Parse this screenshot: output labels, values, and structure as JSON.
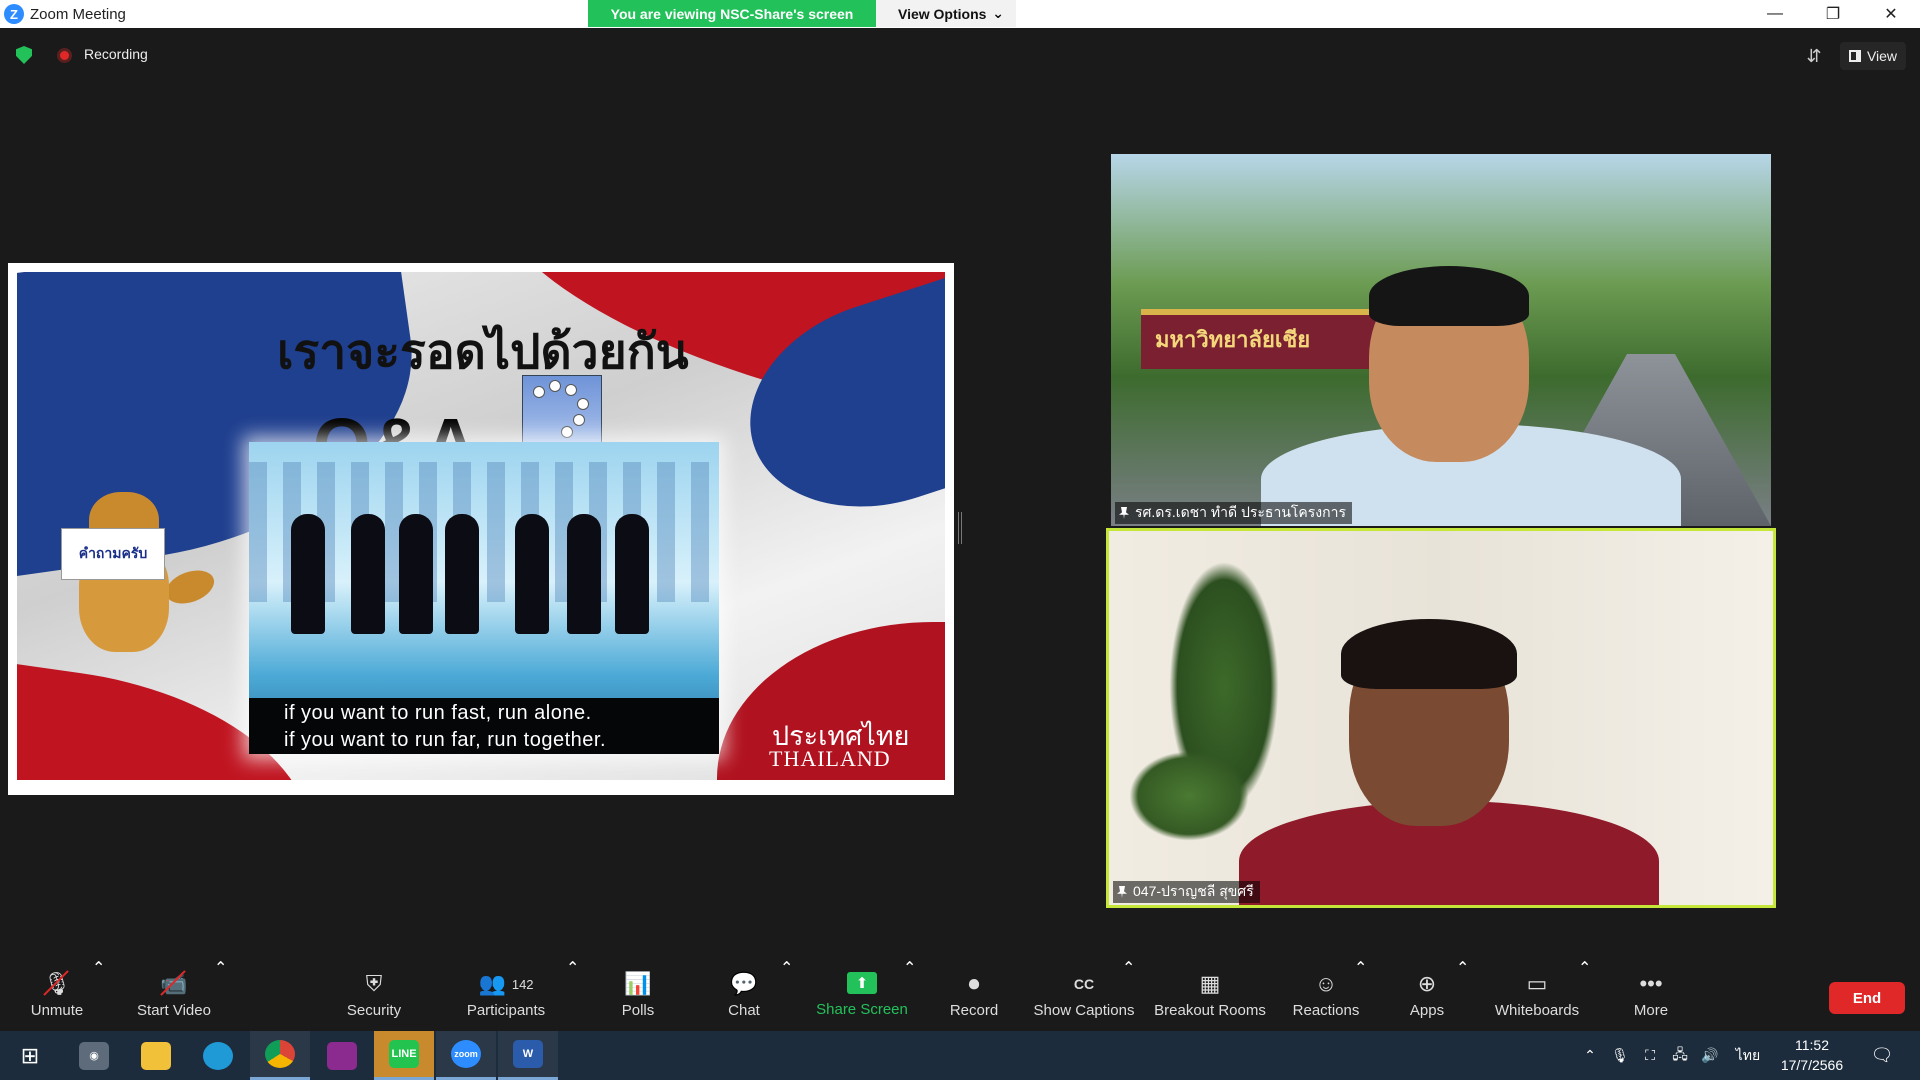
{
  "window": {
    "title": "Zoom Meeting",
    "logo_letter": "Z",
    "controls": {
      "minimize": "—",
      "restore": "❐",
      "close": "✕"
    }
  },
  "share_banner": {
    "viewing_text": "You are viewing NSC-Share's screen",
    "view_options_label": "View Options"
  },
  "top_bar": {
    "recording_label": "Recording",
    "view_label": "View"
  },
  "slide": {
    "thai_title": "เราจะรอดไปด้วยกัน",
    "qa_text": "Q&A",
    "dog_sign": "คำถามครับ",
    "quote_line1": "if you want to run fast, run alone.",
    "quote_line2": "if you want to run far, run together.",
    "country_thai": "ประเทศไทย",
    "country_en": "THAILAND"
  },
  "participants": [
    {
      "name": "รศ.ดร.เดชา ทำดี ประธานโครงการ",
      "sign_text": "มหาวิทยาลัยเชีย"
    },
    {
      "name": "047-ปราญชลี สุขศรี",
      "active_speaker": true
    }
  ],
  "toolbar": {
    "items": [
      {
        "id": "unmute",
        "label": "Unmute",
        "icon": "mic-muted-icon",
        "has_caret": true
      },
      {
        "id": "start-video",
        "label": "Start Video",
        "icon": "video-off-icon",
        "has_caret": true
      },
      {
        "id": "security",
        "label": "Security",
        "icon": "shield-icon",
        "has_caret": false
      },
      {
        "id": "participants",
        "label": "Participants",
        "icon": "participants-icon",
        "count": "142",
        "has_caret": true
      },
      {
        "id": "polls",
        "label": "Polls",
        "icon": "polls-icon",
        "has_caret": false
      },
      {
        "id": "chat",
        "label": "Chat",
        "icon": "chat-icon",
        "has_caret": true
      },
      {
        "id": "share-screen",
        "label": "Share Screen",
        "icon": "share-screen-icon",
        "has_caret": true
      },
      {
        "id": "record",
        "label": "Record",
        "icon": "record-icon",
        "has_caret": false
      },
      {
        "id": "show-captions",
        "label": "Show Captions",
        "icon": "cc-icon",
        "has_caret": true
      },
      {
        "id": "breakout-rooms",
        "label": "Breakout Rooms",
        "icon": "breakout-rooms-icon",
        "has_caret": false
      },
      {
        "id": "reactions",
        "label": "Reactions",
        "icon": "reactions-icon",
        "has_caret": true
      },
      {
        "id": "apps",
        "label": "Apps",
        "icon": "apps-icon",
        "has_caret": true
      },
      {
        "id": "whiteboards",
        "label": "Whiteboards",
        "icon": "whiteboard-icon",
        "has_caret": true
      },
      {
        "id": "more",
        "label": "More",
        "icon": "more-icon",
        "has_caret": false
      }
    ],
    "end_label": "End"
  },
  "taskbar": {
    "apps": [
      "start-icon",
      "camera-app-icon",
      "file-explorer-icon",
      "edge-icon",
      "chrome-icon",
      "winrar-icon",
      "line-icon",
      "zoom-icon",
      "word-icon"
    ],
    "line_label": "LINE",
    "zoom_label": "zoom",
    "word_label": "W",
    "language": "ไทย",
    "time": "11:52",
    "date": "17/7/2566"
  },
  "colors": {
    "zoom_blue": "#2d8cff",
    "share_green": "#23c15a",
    "end_red": "#e02828",
    "active_speaker_border": "#c4e73a",
    "taskbar": "#1d2c3c"
  }
}
